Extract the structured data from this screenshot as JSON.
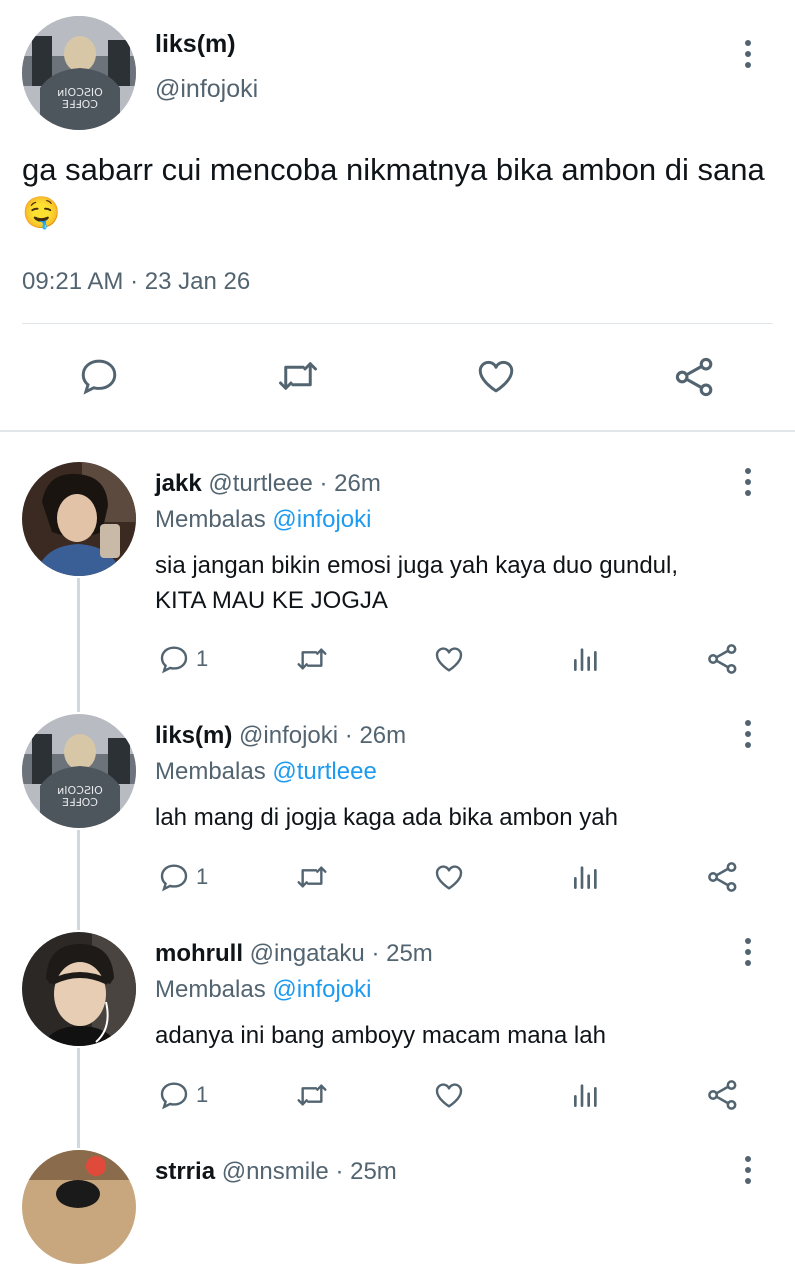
{
  "main_tweet": {
    "name": "liks(m)",
    "handle": "@infojoki",
    "text": "ga sabarr cui mencoba nikmatnya bika ambon di sana",
    "emoji": "🤤",
    "time": "09:21 AM",
    "separator": "·",
    "date": "23 Jan 26",
    "actions": [
      "reply-icon",
      "retweet-icon",
      "like-icon",
      "share-icon"
    ]
  },
  "reply_prefix": "Membalas",
  "replies": [
    {
      "name": "jakk",
      "handle": "@turtleee",
      "age": "· 26m",
      "reply_to": "@infojoki",
      "text_lines": [
        "sia jangan bikin emosi juga yah kaya duo gundul,",
        "KITA MAU KE JOGJA"
      ],
      "reply_count": "1"
    },
    {
      "name": "liks(m)",
      "handle": "@infojoki",
      "age": "· 26m",
      "reply_to": "@turtleee",
      "text_lines": [
        "lah mang di jogja kaga ada bika ambon yah"
      ],
      "reply_count": "1"
    },
    {
      "name": "mohrull",
      "handle": "@ingataku",
      "age": "· 25m",
      "reply_to": "@infojoki",
      "text_lines": [
        "adanya ini bang amboyy macam mana lah"
      ],
      "reply_count": "1"
    },
    {
      "name": "strria",
      "handle": "@nnsmile",
      "age": "· 25m"
    }
  ],
  "colors": {
    "text": "#0f1419",
    "secondary": "#536471",
    "accent_link": "#1d9bf0",
    "divider": "#e1e6ea",
    "thread_line": "#cfd9de"
  }
}
